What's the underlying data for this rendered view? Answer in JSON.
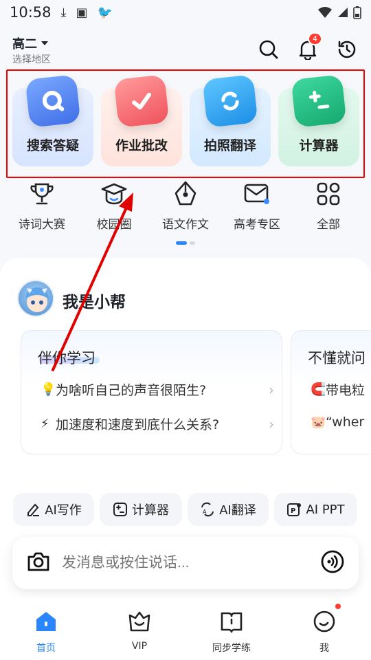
{
  "status_bar": {
    "time": "10:58"
  },
  "header": {
    "grade": "高二",
    "region": "选择地区",
    "notification_count": "4"
  },
  "features": [
    {
      "label": "搜索答疑",
      "icon": "search-icon",
      "color": "#5b8cf7"
    },
    {
      "label": "作业批改",
      "icon": "check-icon",
      "color": "#ff6b6b"
    },
    {
      "label": "拍照翻译",
      "icon": "translate-icon",
      "color": "#2ea7f2"
    },
    {
      "label": "计算器",
      "icon": "calculator-icon",
      "color": "#1fc48a"
    }
  ],
  "shortcuts": [
    {
      "label": "诗词大赛",
      "icon": "trophy-icon"
    },
    {
      "label": "校园圈",
      "icon": "graduation-cap-icon"
    },
    {
      "label": "语文作文",
      "icon": "pen-nib-icon"
    },
    {
      "label": "高考专区",
      "icon": "mail-icon"
    },
    {
      "label": "全部",
      "icon": "grid-icon"
    }
  ],
  "assistant": {
    "name": "我是小帮",
    "cards": [
      {
        "title": "伴你学习",
        "questions": [
          {
            "emoji": "💡",
            "text": "为啥听自己的声音很陌生?"
          },
          {
            "emoji": "⚡",
            "text": "加速度和速度到底什么关系?"
          }
        ]
      },
      {
        "title": "不懂就问",
        "questions": [
          {
            "emoji": "🧲",
            "text": "带电粒"
          },
          {
            "emoji": "🐷",
            "text": "“wher"
          }
        ]
      }
    ]
  },
  "chips": [
    {
      "label": "AI写作",
      "icon": "eraser-pen-icon"
    },
    {
      "label": "计算器",
      "icon": "calculator-icon"
    },
    {
      "label": "AI翻译",
      "icon": "translate-icon"
    },
    {
      "label": "AI PPT",
      "icon": "ppt-icon"
    }
  ],
  "input": {
    "placeholder": "发消息或按住说话..."
  },
  "tabs": [
    {
      "label": "首页",
      "active": true
    },
    {
      "label": "VIP"
    },
    {
      "label": "同步学练"
    },
    {
      "label": "我"
    }
  ],
  "colors": {
    "accent": "#2a86ff",
    "annotation": "#e00000"
  }
}
